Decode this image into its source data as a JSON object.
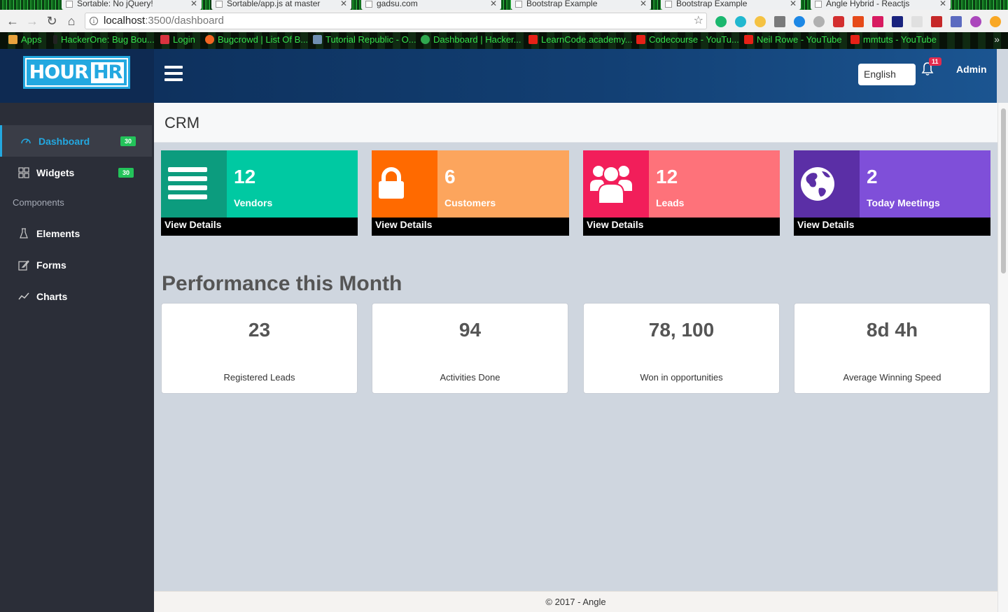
{
  "browser": {
    "tabs": [
      {
        "title": "Sortable: No jQuery!"
      },
      {
        "title": "Sortable/app.js at master"
      },
      {
        "title": "gadsu.com"
      },
      {
        "title": "Bootstrap Example"
      },
      {
        "title": "Bootstrap Example"
      },
      {
        "title": "Angle Hybrid - Reactjs"
      }
    ],
    "url_host": "localhost",
    "url_path": ":3500/dashboard",
    "bookmarks": [
      {
        "label": "Apps",
        "color": "#e8a33d"
      },
      {
        "label": "HackerOne: Bug Bou...",
        "color": "#222222"
      },
      {
        "label": "Login",
        "color": "#d9333f"
      },
      {
        "label": "Bugcrowd | List Of B...",
        "color": "#f26522"
      },
      {
        "label": "Tutorial Republic - O...",
        "color": "#6f8fb3"
      },
      {
        "label": "Dashboard | Hacker...",
        "color": "#2fa84f"
      },
      {
        "label": "LearnCode.academy...",
        "color": "#e62117"
      },
      {
        "label": "Codecourse - YouTu...",
        "color": "#e62117"
      },
      {
        "label": "Neil Rowe - YouTube",
        "color": "#e62117"
      },
      {
        "label": "mmtuts - YouTube",
        "color": "#e62117"
      }
    ],
    "more_label": "»"
  },
  "header": {
    "logo_left": "HOUR",
    "logo_right": "HR",
    "language": "English",
    "notifications": "11",
    "user": "Admin"
  },
  "sidebar": {
    "items": [
      {
        "label": "Dashboard",
        "badge": "30",
        "icon": "dashboard-icon",
        "active": true
      },
      {
        "label": "Widgets",
        "badge": "30",
        "icon": "grid-icon",
        "active": false
      }
    ],
    "section_heading": "Components",
    "components": [
      {
        "label": "Elements",
        "icon": "beaker-icon"
      },
      {
        "label": "Forms",
        "icon": "edit-icon"
      },
      {
        "label": "Charts",
        "icon": "chart-line-icon"
      }
    ]
  },
  "page": {
    "title": "CRM",
    "stats": [
      {
        "value": "12",
        "label": "Vendors",
        "footer": "View Details",
        "icon": "list-icon",
        "icon_color": "#0c9c7e",
        "body_color": "#00c9a2"
      },
      {
        "value": "6",
        "label": "Customers",
        "footer": "View Details",
        "icon": "lock-icon",
        "icon_color": "#ff6a00",
        "body_color": "#fca55d"
      },
      {
        "value": "12",
        "label": "Leads",
        "footer": "View Details",
        "icon": "users-icon",
        "icon_color": "#f21e5a",
        "body_color": "#fe727a"
      },
      {
        "value": "2",
        "label": "Today Meetings",
        "footer": "View Details",
        "icon": "globe-icon",
        "icon_color": "#5b2fa6",
        "body_color": "#7f4fd9"
      }
    ],
    "performance_title": "Performance this Month",
    "performance": [
      {
        "value": "23",
        "label": "Registered Leads"
      },
      {
        "value": "94",
        "label": "Activities Done"
      },
      {
        "value": "78, 100",
        "label": "Won in opportunities"
      },
      {
        "value": "8d 4h",
        "label": "Average Winning Speed"
      }
    ],
    "footer": "© 2017 - Angle"
  }
}
